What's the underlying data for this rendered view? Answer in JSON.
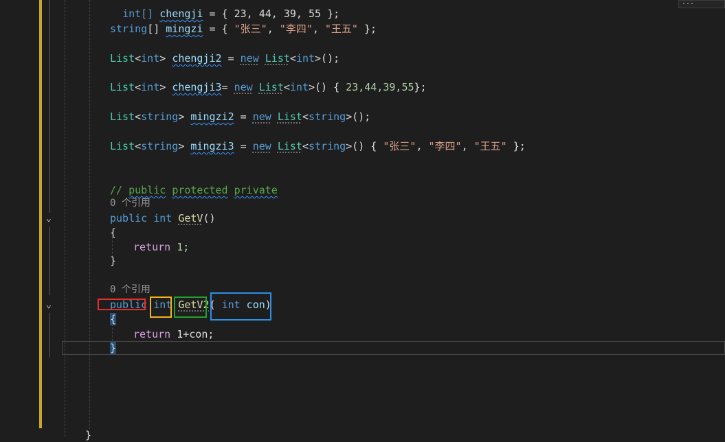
{
  "editor": {
    "lines": {
      "l0": {
        "type": "int[] ",
        "name": "chengji",
        "rest": " = { 23, 44, 39, 55 };"
      },
      "l1": {
        "type": "string",
        "arr": "[] ",
        "name": "mingzi",
        "eq": " = { ",
        "s1": "\"张三\"",
        "c1": ", ",
        "s2": "\"李四\"",
        "c2": ", ",
        "s3": "\"王五\"",
        "end": " };"
      },
      "l2": {
        "t1": "List",
        "lt": "<",
        "t2": "int",
        "gt": "> ",
        "name": "chengji2",
        "eq": " = ",
        "new": "new",
        "sp": " ",
        "t3": "List",
        "lt2": "<",
        "t4": "int",
        "end": ">();"
      },
      "l3": {
        "t1": "List",
        "lt": "<",
        "t2": "int",
        "gt": "> ",
        "name": "chengji3",
        "eq": "= ",
        "new": "new",
        "sp": " ",
        "t3": "List",
        "lt2": "<",
        "t4": "int",
        "mid": ">() { ",
        "nums": "23,44,39,55",
        "end": "};"
      },
      "l4": {
        "t1": "List",
        "lt": "<",
        "t2": "string",
        "gt": "> ",
        "name": "mingzi2",
        "eq": " = ",
        "new": "new",
        "sp": " ",
        "t3": "List",
        "lt2": "<",
        "t4": "string",
        "end": ">();"
      },
      "l5": {
        "t1": "List",
        "lt": "<",
        "t2": "string",
        "gt": "> ",
        "name": "mingzi3",
        "eq": " = ",
        "new": "new",
        "sp": " ",
        "t3": "List",
        "lt2": "<",
        "t4": "string",
        "mid": ">() { ",
        "s1": "\"张三\"",
        "c1": ", ",
        "s2": "\"李四\"",
        "c2": ", ",
        "s3": "\"王五\"",
        "end": " };"
      },
      "comment": {
        "slash": "// ",
        "w1": "public",
        "sp1": " ",
        "w2": "protected",
        "sp2": " ",
        "w3": "private"
      },
      "lens1": "0 个引用",
      "m1": {
        "pub": "public",
        "sp": " ",
        "ty": "int",
        "sp2": " ",
        "name": "GetV",
        "end": "()"
      },
      "b1o": "{",
      "r1": {
        "ret": "return",
        "val": " 1;"
      },
      "b1c": "}",
      "lens2": "0 个引用",
      "m2": {
        "pub": "public",
        "sp": " ",
        "ty": "int",
        "sp2": " ",
        "name": "GetV2",
        "po": "(",
        "sp3": " ",
        "pty": "int",
        "pname": " con",
        "pc": ")"
      },
      "b2o": "{",
      "r2": {
        "ret": "return",
        "val": " 1+con;"
      },
      "b2c": "}",
      "last": "}"
    },
    "mini_button": "..."
  },
  "annotations": {
    "colors": {
      "red": "#e8302a",
      "yellow": "#f2b51c",
      "green": "#22a12a",
      "blue": "#2c8fe8"
    }
  }
}
